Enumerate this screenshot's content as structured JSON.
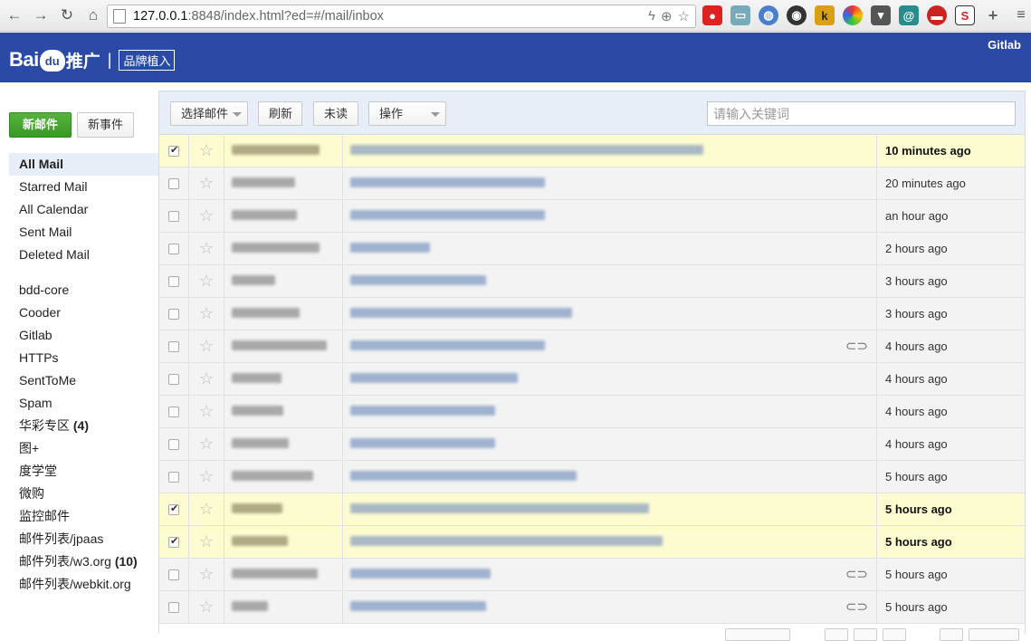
{
  "browser": {
    "url_host": "127.0.0.1",
    "url_rest": ":8848/index.html?ed=#/mail/inbox"
  },
  "header": {
    "logo_bai": "Bai",
    "logo_du": "du",
    "logo_tg": "推广",
    "logo_sep": "|",
    "logo_sub": "品牌植入",
    "gitlab": "Gitlab"
  },
  "sidebar": {
    "new_mail": "新邮件",
    "new_event": "新事件",
    "primary": [
      {
        "label": "All Mail"
      },
      {
        "label": "Starred Mail"
      },
      {
        "label": "All Calendar"
      },
      {
        "label": "Sent Mail"
      },
      {
        "label": "Deleted Mail"
      }
    ],
    "folders": [
      {
        "label": "bdd-core",
        "count": ""
      },
      {
        "label": "Cooder",
        "count": ""
      },
      {
        "label": "Gitlab",
        "count": ""
      },
      {
        "label": "HTTPs",
        "count": ""
      },
      {
        "label": "SentToMe",
        "count": ""
      },
      {
        "label": "Spam",
        "count": ""
      },
      {
        "label": "华彩专区",
        "count": "(4)"
      },
      {
        "label": "图+",
        "count": ""
      },
      {
        "label": "度学堂",
        "count": ""
      },
      {
        "label": "微购",
        "count": ""
      },
      {
        "label": "监控邮件",
        "count": ""
      },
      {
        "label": "邮件列表/jpaas",
        "count": ""
      },
      {
        "label": "邮件列表/w3.org",
        "count": "(10)"
      },
      {
        "label": "邮件列表/webkit.org",
        "count": ""
      }
    ]
  },
  "toolbar": {
    "select_mail": "选择邮件",
    "refresh": "刷新",
    "unread": "未读",
    "actions": "操作",
    "search_placeholder": "请输入关键词"
  },
  "mails": [
    {
      "checked": true,
      "time": "10 minutes ago",
      "attachment": false
    },
    {
      "checked": false,
      "time": "20 minutes ago",
      "attachment": false
    },
    {
      "checked": false,
      "time": "an hour ago",
      "attachment": false
    },
    {
      "checked": false,
      "time": "2 hours ago",
      "attachment": false
    },
    {
      "checked": false,
      "time": "3 hours ago",
      "attachment": false
    },
    {
      "checked": false,
      "time": "3 hours ago",
      "attachment": false
    },
    {
      "checked": false,
      "time": "4 hours ago",
      "attachment": true
    },
    {
      "checked": false,
      "time": "4 hours ago",
      "attachment": false
    },
    {
      "checked": false,
      "time": "4 hours ago",
      "attachment": false
    },
    {
      "checked": false,
      "time": "4 hours ago",
      "attachment": false
    },
    {
      "checked": false,
      "time": "5 hours ago",
      "attachment": false
    },
    {
      "checked": true,
      "time": "5 hours ago",
      "attachment": false
    },
    {
      "checked": true,
      "time": "5 hours ago",
      "attachment": false
    },
    {
      "checked": false,
      "time": "5 hours ago",
      "attachment": true
    },
    {
      "checked": false,
      "time": "5 hours ago",
      "attachment": true
    }
  ],
  "icons": {
    "star": "☆",
    "attachment": "⊂⊃"
  }
}
